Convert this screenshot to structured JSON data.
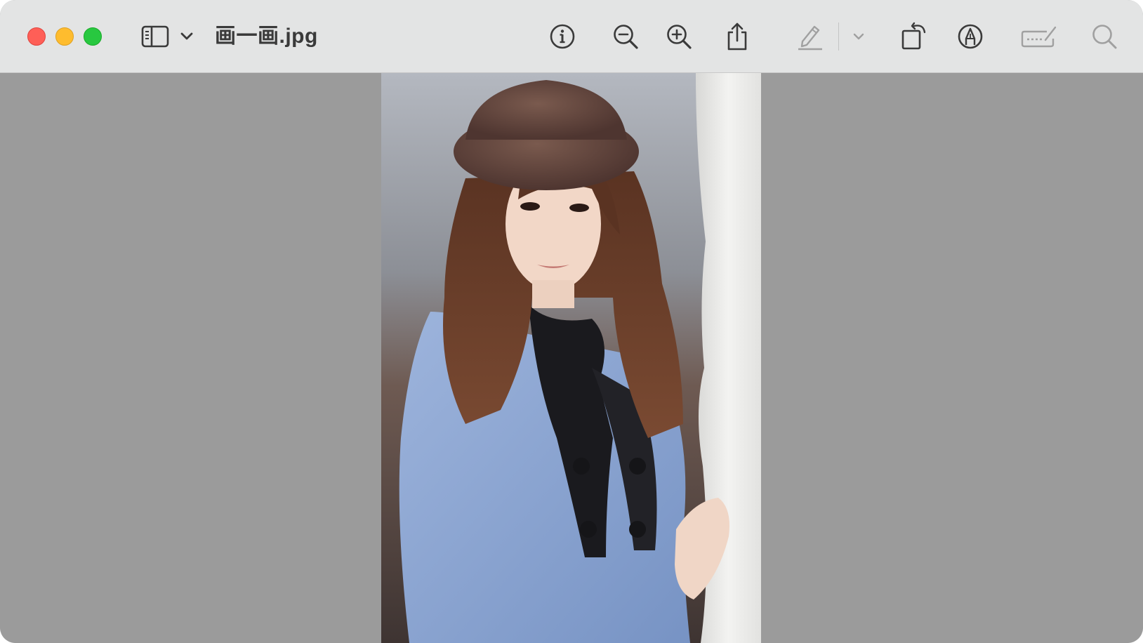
{
  "window": {
    "title": "画一画.jpg"
  },
  "toolbar": {
    "buttons": [
      {
        "name": "sidebar-toggle",
        "icon": "sidebar-icon"
      },
      {
        "name": "sidebar-menu",
        "icon": "chevron-down-icon"
      },
      {
        "name": "info",
        "icon": "info-icon"
      },
      {
        "name": "zoom-out",
        "icon": "zoom-out-icon"
      },
      {
        "name": "zoom-in",
        "icon": "zoom-in-icon"
      },
      {
        "name": "share",
        "icon": "share-icon"
      },
      {
        "name": "highlight",
        "icon": "pencil-icon"
      },
      {
        "name": "highlight-menu",
        "icon": "chevron-down-icon"
      },
      {
        "name": "rotate",
        "icon": "rotate-icon"
      },
      {
        "name": "markup",
        "icon": "markup-icon"
      },
      {
        "name": "form-filling",
        "icon": "signature-icon"
      },
      {
        "name": "search",
        "icon": "search-icon"
      }
    ]
  },
  "colors": {
    "titlebar": "#e3e4e4",
    "canvas": "#9b9b9b",
    "close": "#fe5f57",
    "minimize": "#febc2e",
    "zoom": "#28c840",
    "icon": "#3a3a3a",
    "icon_disabled": "#a0a0a0"
  },
  "image": {
    "subject": "photo-portrait"
  }
}
